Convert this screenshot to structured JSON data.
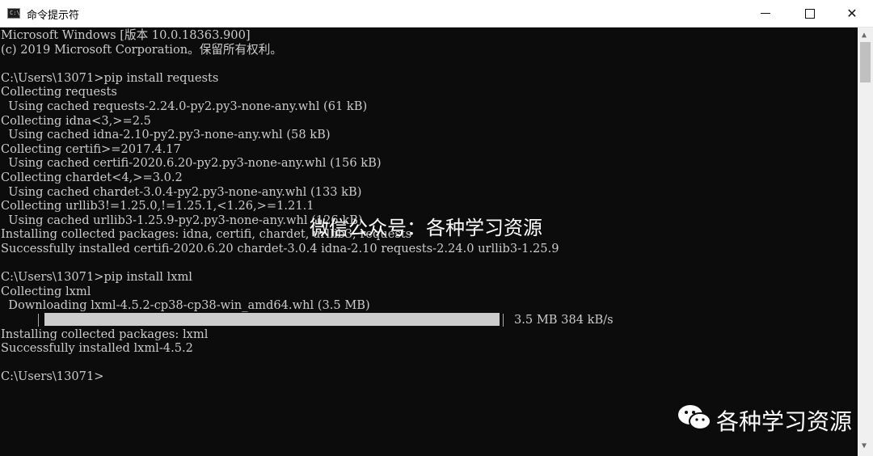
{
  "window": {
    "title": "命令提示符",
    "icon_label": "C:\\",
    "minimize_glyph": "—",
    "maximize_glyph": "□",
    "close_glyph": "✕"
  },
  "console": {
    "lines": [
      "Microsoft Windows [版本 10.0.18363.900]",
      "(c) 2019 Microsoft Corporation。保留所有权利。",
      "",
      "C:\\Users\\13071>pip install requests",
      "Collecting requests",
      "  Using cached requests-2.24.0-py2.py3-none-any.whl (61 kB)",
      "Collecting idna<3,>=2.5",
      "  Using cached idna-2.10-py2.py3-none-any.whl (58 kB)",
      "Collecting certifi>=2017.4.17",
      "  Using cached certifi-2020.6.20-py2.py3-none-any.whl (156 kB)",
      "Collecting chardet<4,>=3.0.2",
      "  Using cached chardet-3.0.4-py2.py3-none-any.whl (133 kB)",
      "Collecting urllib3!=1.25.0,!=1.25.1,<1.26,>=1.21.1",
      "  Using cached urllib3-1.25.9-py2.py3-none-any.whl (126 kB)",
      "Installing collected packages: idna, certifi, chardet, urllib3, requests",
      "Successfully installed certifi-2020.6.20 chardet-3.0.4 idna-2.10 requests-2.24.0 urllib3-1.25.9",
      "",
      "C:\\Users\\13071>pip install lxml",
      "Collecting lxml",
      "  Downloading lxml-4.5.2-cp38-cp38-win_amd64.whl (3.5 MB)",
      "",
      "Installing collected packages: lxml",
      "Successfully installed lxml-4.5.2",
      "",
      "C:\\Users\\13071>"
    ],
    "progress": {
      "fraction": 1.0,
      "text": "3.5 MB 384 kB/s"
    }
  },
  "watermark": {
    "center_text": "微信公众号：各种学习资源",
    "corner_text": "各种学习资源",
    "logo_icon": "wechat-logo"
  },
  "colors": {
    "console_bg": "#0c0c0c",
    "console_text": "#cccccc"
  }
}
